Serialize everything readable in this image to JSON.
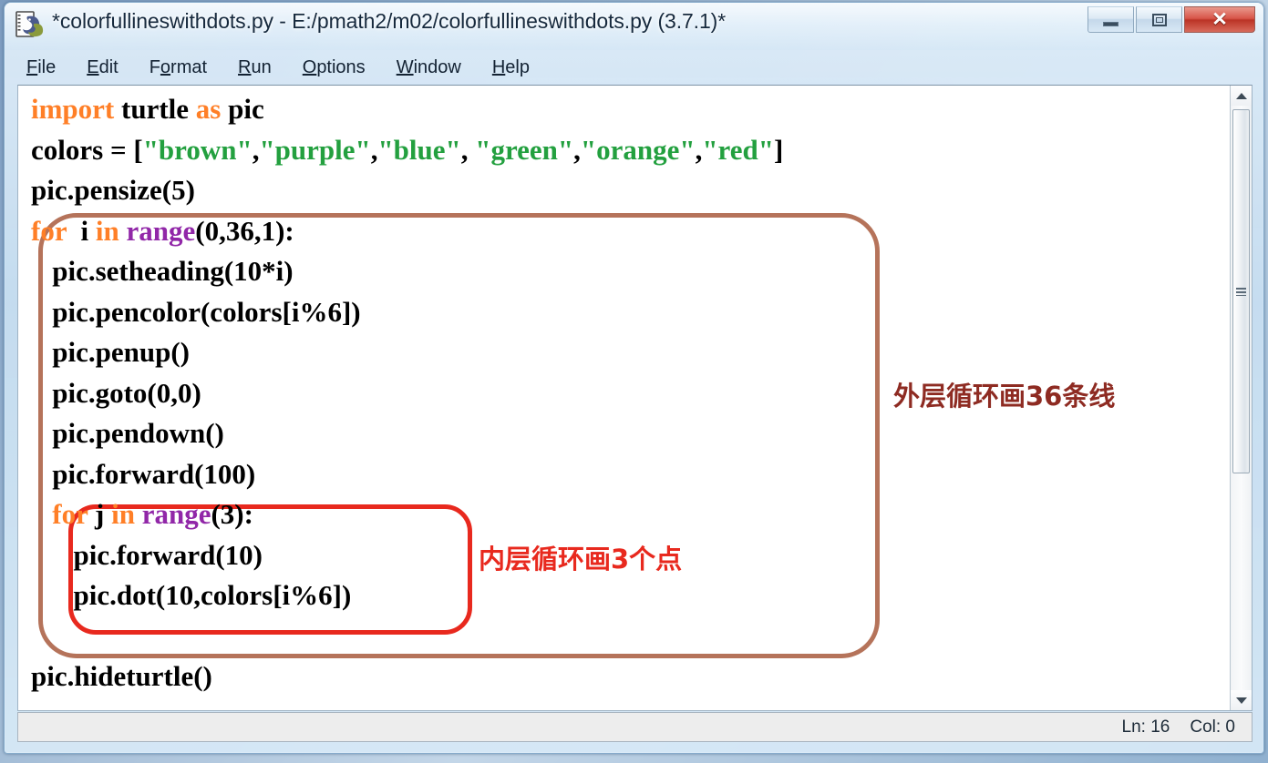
{
  "window": {
    "title": "*colorfullineswithdots.py - E:/pmath2/m02/colorfullineswithdots.py (3.7.1)*",
    "icon": "python-idle-icon",
    "controls": {
      "minimize": "minimize-icon",
      "maximize": "restore-icon",
      "close": "✕"
    }
  },
  "menubar": {
    "items": [
      {
        "pre": "",
        "accel": "F",
        "post": "ile"
      },
      {
        "pre": "",
        "accel": "E",
        "post": "dit"
      },
      {
        "pre": "F",
        "accel": "o",
        "post": "rmat"
      },
      {
        "pre": "",
        "accel": "R",
        "post": "un"
      },
      {
        "pre": "",
        "accel": "O",
        "post": "ptions"
      },
      {
        "pre": "",
        "accel": "W",
        "post": "indow"
      },
      {
        "pre": "",
        "accel": "H",
        "post": "elp"
      }
    ]
  },
  "editor": {
    "lines": [
      [
        {
          "t": "import",
          "c": "kw"
        },
        {
          "t": " turtle ",
          "c": ""
        },
        {
          "t": "as",
          "c": "kw"
        },
        {
          "t": " pic",
          "c": ""
        }
      ],
      [
        {
          "t": "colors = [",
          "c": ""
        },
        {
          "t": "\"brown\"",
          "c": "str"
        },
        {
          "t": ",",
          "c": ""
        },
        {
          "t": "\"purple\"",
          "c": "str"
        },
        {
          "t": ",",
          "c": ""
        },
        {
          "t": "\"blue\"",
          "c": "str"
        },
        {
          "t": ", ",
          "c": ""
        },
        {
          "t": "\"green\"",
          "c": "str"
        },
        {
          "t": ",",
          "c": ""
        },
        {
          "t": "\"orange\"",
          "c": "str"
        },
        {
          "t": ",",
          "c": ""
        },
        {
          "t": "\"red\"",
          "c": "str"
        },
        {
          "t": "]",
          "c": ""
        }
      ],
      [
        {
          "t": "pic.pensize(5)",
          "c": ""
        }
      ],
      [
        {
          "t": "for",
          "c": "kw"
        },
        {
          "t": "  i ",
          "c": ""
        },
        {
          "t": "in",
          "c": "kw"
        },
        {
          "t": " ",
          "c": ""
        },
        {
          "t": "range",
          "c": "bi"
        },
        {
          "t": "(0,36,1):",
          "c": ""
        }
      ],
      [
        {
          "t": "   pic.setheading(10*i)",
          "c": ""
        }
      ],
      [
        {
          "t": "   pic.pencolor(colors[i%6])",
          "c": ""
        }
      ],
      [
        {
          "t": "   pic.penup()",
          "c": ""
        }
      ],
      [
        {
          "t": "   pic.goto(0,0)",
          "c": ""
        }
      ],
      [
        {
          "t": "   pic.pendown()",
          "c": ""
        }
      ],
      [
        {
          "t": "   pic.forward(100)",
          "c": ""
        }
      ],
      [
        {
          "t": "   ",
          "c": ""
        },
        {
          "t": "for",
          "c": "kw"
        },
        {
          "t": " j ",
          "c": ""
        },
        {
          "t": "in",
          "c": "kw"
        },
        {
          "t": " ",
          "c": ""
        },
        {
          "t": "range",
          "c": "bi"
        },
        {
          "t": "(3):",
          "c": ""
        }
      ],
      [
        {
          "t": "      pic.forward(10)",
          "c": ""
        }
      ],
      [
        {
          "t": "      pic.dot(10,colors[i%6])",
          "c": ""
        }
      ],
      [
        {
          "t": "",
          "c": ""
        }
      ],
      [
        {
          "t": "pic.hideturtle()",
          "c": ""
        }
      ]
    ],
    "annotations": {
      "outer_loop_label": "外层循环画36条线",
      "inner_loop_label": "内层循环画3个点",
      "outer_box_color": "#b5735a",
      "inner_box_color": "#e8291e"
    },
    "syntax_colors": {
      "keyword": "#ff7f27",
      "string": "#23a03f",
      "builtin": "#9127a8",
      "plain": "#000000"
    },
    "scrollbar": {
      "up_arrow": "scroll-up-icon",
      "down_arrow": "scroll-down-icon",
      "thumb": "scroll-thumb"
    }
  },
  "statusbar": {
    "line": "Ln: 16",
    "col": "Col: 0"
  }
}
